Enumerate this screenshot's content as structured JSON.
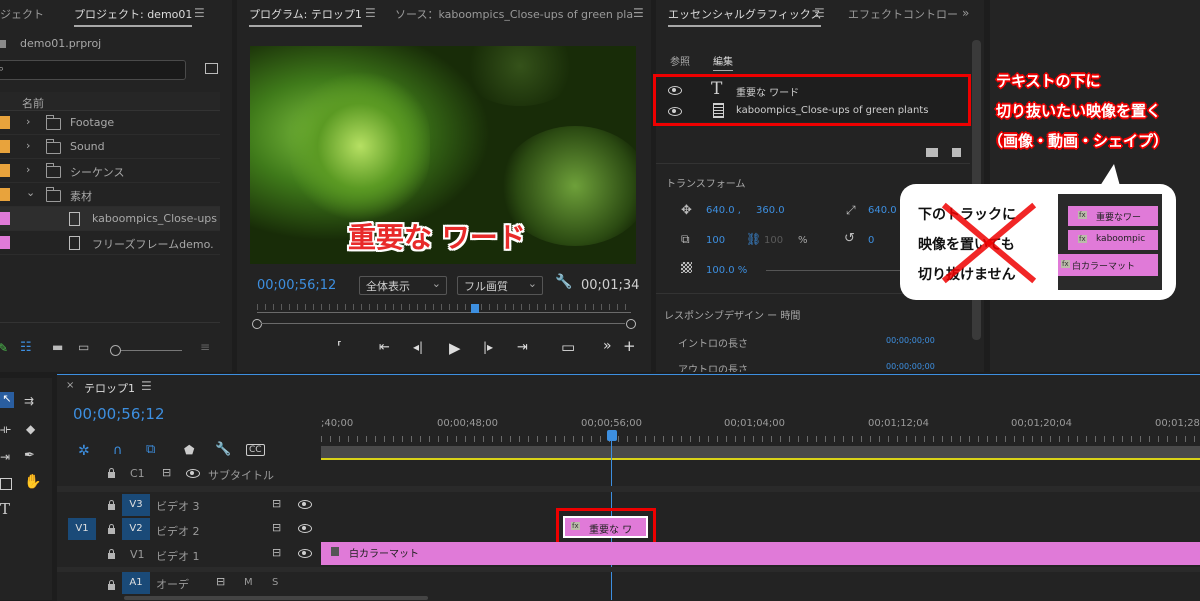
{
  "project_panel": {
    "tab_left": "ジェクト",
    "tab_project": "プロジェクト: demo01",
    "file": "demo01.prproj",
    "column_name": "名前",
    "items": [
      {
        "label": "Footage",
        "color": "#e8a33c"
      },
      {
        "label": "Sound",
        "color": "#e8a33c"
      },
      {
        "label": "シーケンス",
        "color": "#e8a33c"
      },
      {
        "label": "素材",
        "color": "#e8a33c"
      },
      {
        "label": "kaboompics_Close-ups",
        "color": "#e07ad8"
      },
      {
        "label": "フリーズフレームdemo.",
        "color": "#e07ad8"
      }
    ]
  },
  "program_monitor": {
    "tab_program": "プログラム: テロップ1",
    "tab_source": "ソース：kaboompics_Close-ups of green pla",
    "overlay_text": "重要な ワード",
    "timecode": "00;00;56;12",
    "zoom_select": "全体表示",
    "quality_select": "フル画質",
    "duration": "00;01;34"
  },
  "essential_graphics": {
    "tab_active": "エッセンシャルグラフィックス",
    "tab_effects": "エフェクトコントロー",
    "subtab_browse": "参照",
    "subtab_edit": "編集",
    "layers": [
      {
        "label": "重要な ワード",
        "type": "text"
      },
      {
        "label": "kaboompics_Close-ups of green plants",
        "type": "clip"
      }
    ],
    "transform_title": "トランスフォーム",
    "pos_x": "640.0 ,",
    "pos_y": "360.0",
    "anchor_x": "640.0",
    "scale": "100",
    "scale_h": "100",
    "percent": "%",
    "rotation": "0",
    "opacity": "100.0 %",
    "responsive_title": "レスポンシブデザイン ー 時間",
    "intro_label": "イントロの長さ",
    "intro_value": "00;00;00;00",
    "outro_label": "アウトロの長さ",
    "outro_value": "00;00;00;00"
  },
  "annotation": {
    "line1": "テキストの下に",
    "line2": "切り抜いたい映像を置く",
    "line3": "（画像・動画・シェイプ）",
    "bubble_line1": "下のトラックに",
    "bubble_line2": "映像を置いても",
    "bubble_line3": "切り抜けません",
    "mini_clip1": "重要なワー",
    "mini_clip2": "kaboompic",
    "mini_clip3": "白カラーマット",
    "accent": "#e00000"
  },
  "timeline": {
    "tab": "テロップ1",
    "timecode": "00;00;56;12",
    "ruler": [
      ";40;00",
      "00;00;48;00",
      "00;00;56;00",
      "00;01;04;00",
      "00;01;12;04",
      "00;01;20;04",
      "00;01;28"
    ],
    "tracks": {
      "c1": "C1",
      "c1_name": "サブタイトル",
      "v3": "V3",
      "v3_name": "ビデオ 3",
      "v2": "V2",
      "v2_name": "ビデオ 2",
      "v1_src": "V1",
      "v1": "V1",
      "v1_name": "ビデオ 1",
      "a1": "A1",
      "a1_name": "オーデ",
      "m": "M",
      "s": "S"
    },
    "clips": {
      "text_clip": "重要な ワ",
      "matte_clip": "白カラーマット",
      "fx": "fx"
    }
  }
}
